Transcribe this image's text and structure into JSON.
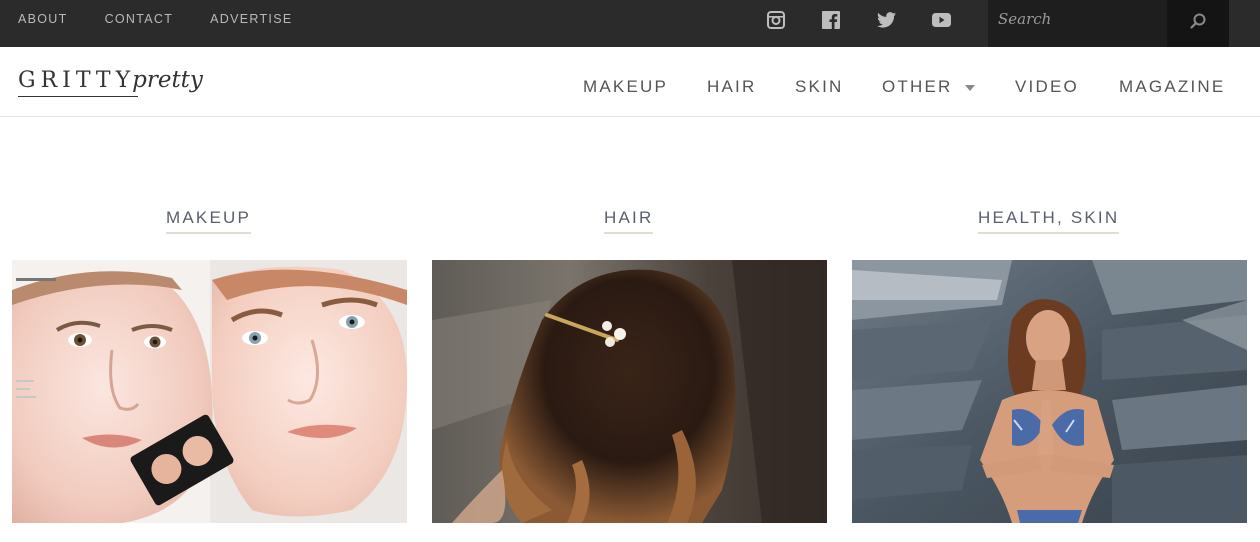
{
  "topbar": {
    "links": [
      "ABOUT",
      "CONTACT",
      "ADVERTISE"
    ],
    "social_icons": [
      "instagram-icon",
      "facebook-icon",
      "twitter-icon",
      "youtube-icon"
    ],
    "search": {
      "placeholder": "Search",
      "value": ""
    }
  },
  "header": {
    "logo": {
      "word1": "GRITTY",
      "word2": "pretty"
    },
    "nav": [
      "MAKEUP",
      "HAIR",
      "SKIN",
      "OTHER",
      "VIDEO",
      "MAGAZINE"
    ]
  },
  "categories": [
    {
      "title": "MAKEUP"
    },
    {
      "title": "HAIR"
    },
    {
      "title": "HEALTH, SKIN"
    }
  ],
  "colors": {
    "topbar_bg": "#2b2b2b",
    "nav_text": "#555555",
    "category_text": "#5a5f6e",
    "category_underline": "#e2ddd3"
  }
}
